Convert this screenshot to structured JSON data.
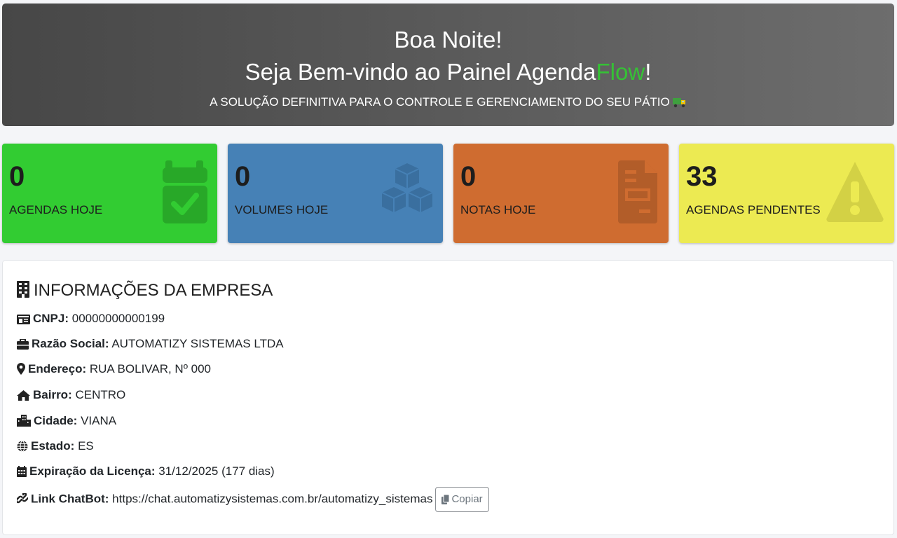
{
  "hero": {
    "greeting": "Boa Noite!",
    "welcome_prefix": "Seja Bem-vindo ao Painel Agenda",
    "welcome_brand": "Flow",
    "welcome_suffix": "!",
    "tagline": "A SOLUÇÃO DEFINITIVA PARA O CONTROLE E GERENCIAMENTO DO SEU PÁTIO",
    "tagline_icon": "truck-icon"
  },
  "cards": [
    {
      "value": "0",
      "label": "AGENDAS HOJE",
      "icon": "calendar-check-icon",
      "color": "#32cc32"
    },
    {
      "value": "0",
      "label": "VOLUMES HOJE",
      "icon": "cubes-icon",
      "color": "#4681b6"
    },
    {
      "value": "0",
      "label": "NOTAS HOJE",
      "icon": "file-invoice-icon",
      "color": "#cf6c30"
    },
    {
      "value": "33",
      "label": "AGENDAS PENDENTES",
      "icon": "warning-icon",
      "color": "#ecea52"
    }
  ],
  "company": {
    "title": "INFORMAÇÕES DA EMPRESA",
    "fields": [
      {
        "label": "CNPJ:",
        "value": "00000000000199",
        "icon": "id-card-icon"
      },
      {
        "label": "Razão Social:",
        "value": "AUTOMATIZY SISTEMAS LTDA",
        "icon": "briefcase-icon"
      },
      {
        "label": "Endereço:",
        "value": "RUA BOLIVAR, Nº 000",
        "icon": "map-marker-icon"
      },
      {
        "label": "Bairro:",
        "value": "CENTRO",
        "icon": "home-icon"
      },
      {
        "label": "Cidade:",
        "value": "VIANA",
        "icon": "city-icon"
      },
      {
        "label": "Estado:",
        "value": "ES",
        "icon": "globe-icon"
      },
      {
        "label": "Expiração da Licença:",
        "value": "31/12/2025 (177 dias)",
        "icon": "calendar-icon"
      },
      {
        "label": "Link ChatBot:",
        "value": "https://chat.automatizysistemas.com.br/automatizy_sistemas",
        "icon": "link-icon"
      }
    ],
    "copy_label": "Copiar"
  }
}
